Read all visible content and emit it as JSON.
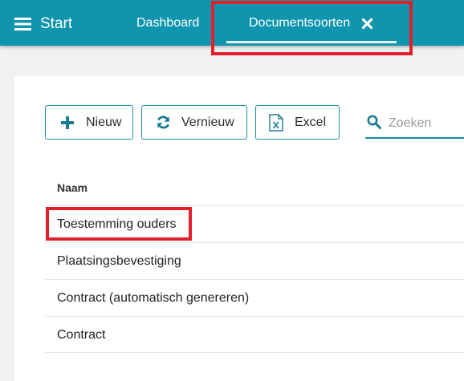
{
  "header": {
    "app_title": "Start",
    "menu_icon": "hamburger-menu-icon",
    "tabs": [
      {
        "label": "Dashboard",
        "active": false
      },
      {
        "label": "Documentsoorten",
        "active": true,
        "closable": true,
        "close_icon": "close-icon"
      }
    ]
  },
  "toolbar": {
    "new_label": "Nieuw",
    "new_icon": "plus-icon",
    "refresh_label": "Vernieuw",
    "refresh_icon": "refresh-icon",
    "excel_label": "Excel",
    "excel_icon": "excel-file-icon",
    "search_placeholder": "Zoeken",
    "search_value": "",
    "search_icon": "search-icon"
  },
  "table": {
    "columns": [
      "Naam"
    ],
    "rows": [
      {
        "name": "Toestemming ouders"
      },
      {
        "name": "Plaatsingsbevestiging"
      },
      {
        "name": "Contract (automatisch genereren)"
      },
      {
        "name": "Contract"
      }
    ]
  },
  "colors": {
    "header_bg": "#0f95ad",
    "accent": "#1a8ea6",
    "highlight": "#e3202a",
    "page_bg": "#f1f1f1"
  }
}
